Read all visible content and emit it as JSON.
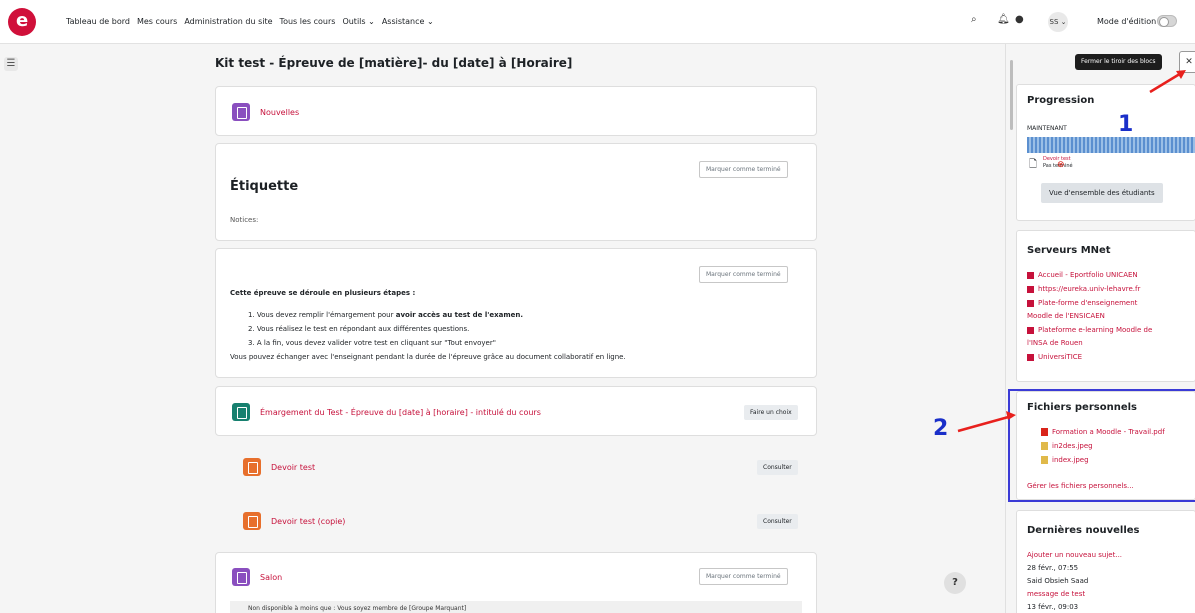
{
  "nav": {
    "items": [
      "Tableau de bord",
      "Mes cours",
      "Administration du site",
      "Tous les cours",
      "Outils ⌄",
      "Assistance ⌄"
    ],
    "avatar_initials": "SS ⌄",
    "edit_mode_label": "Mode d'édition"
  },
  "page": {
    "title": "Kit test - Épreuve de [matière]- du [date] à [Horaire]"
  },
  "sections": {
    "news_link": "Nouvelles",
    "label_heading": "Étiquette",
    "notices_text": "Notices:",
    "mark_done": "Marquer comme terminé",
    "steps_intro": "Cette épreuve se déroule en plusieurs étapes :",
    "step1_a": "1. Vous devez remplir l'émargement pour ",
    "step1_b": "avoir accès au test de l'examen.",
    "step2": "2. Vous réalisez le test en répondant aux différentes questions.",
    "step3": "3. A la fin, vous devez valider votre test en cliquant sur \"Tout envoyer\"",
    "exchange": "Vous pouvez échanger avec l'enseignant pendant la durée de l'épreuve grâce au document collaboratif en ligne.",
    "choice_link": "Émargement du Test - Épreuve du [date] à [horaire] - intitulé du cours",
    "choice_button": "Faire un choix",
    "assign1_link": "Devoir test",
    "assign2_link": "Devoir test (copie)",
    "consult": "Consulter",
    "salon_link": "Salon",
    "restriction": "Non disponible à moins que : Vous soyez membre de [Groupe Marquant]"
  },
  "right": {
    "close_tooltip": "Fermer le tiroir des blocs",
    "close_glyph": "✕",
    "progress_title": "Progression",
    "now_label": "MAINTENANT",
    "progress_fraction": 1.0,
    "devoir_small": "Devoir test",
    "not_done": "Pas terminé",
    "overview_btn": "Vue d'ensemble des étudiants",
    "mnet_title": "Serveurs MNet",
    "mnet_1": "Accueil - Eportfolio UNICAEN",
    "mnet_2": "https://eureka.univ-lehavre.fr",
    "mnet_3a": "Plate-forme d'enseignement",
    "mnet_3b": "Moodle de l'ENSICAEN",
    "mnet_4a": "Plateforme e-learning Moodle de",
    "mnet_4b": "l'INSA de Rouen",
    "mnet_5": "UniversiTICE",
    "files_title": "Fichiers personnels",
    "file_1": "Formation a Moodle - Travail.pdf",
    "file_2": "in2des.jpeg",
    "file_3": "index.jpeg",
    "manage_files": "Gérer les fichiers personnels...",
    "news_title": "Dernières nouvelles",
    "add_topic": "Ajouter un nouveau sujet...",
    "news_date": "28 févr., 07:55",
    "news_author": "Said Obsieh Saad",
    "news_msg": "message de test",
    "news_date2": "13 févr., 09:03"
  },
  "annotations": {
    "one": "1",
    "two": "2"
  },
  "help_glyph": "?"
}
